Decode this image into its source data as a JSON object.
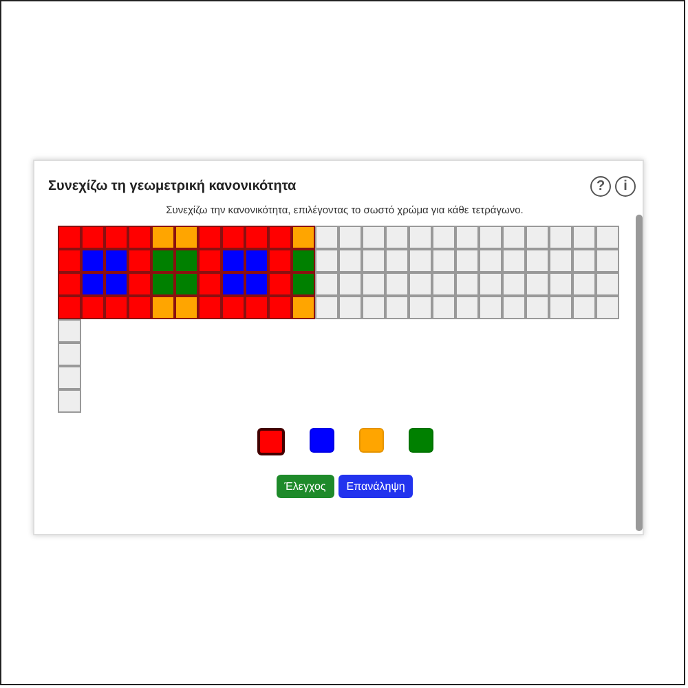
{
  "card": {
    "title": "Συνεχίζω τη γεωμετρική κανονικότητα",
    "icons": [
      "?",
      "i"
    ]
  },
  "instruction": "Συνεχίζω την κανονικότητα, επιλέγοντας το σωστό χρώμα για κάθε τετράγωνο.",
  "grid": {
    "rows": [
      [
        {
          "kind": "filled",
          "color": "#ff0000"
        },
        {
          "kind": "filled",
          "color": "#ff0000"
        },
        {
          "kind": "filled",
          "color": "#ff0000"
        },
        {
          "kind": "filled",
          "color": "#ff0000"
        },
        {
          "kind": "filled",
          "color": "#ffa500"
        },
        {
          "kind": "filled",
          "color": "#ffa500"
        },
        {
          "kind": "filled",
          "color": "#ff0000"
        },
        {
          "kind": "filled",
          "color": "#ff0000"
        },
        {
          "kind": "filled",
          "color": "#ff0000"
        },
        {
          "kind": "filled",
          "color": "#ff0000"
        },
        {
          "kind": "filled",
          "color": "#ffa500"
        },
        {
          "kind": "empty"
        },
        {
          "kind": "empty"
        },
        {
          "kind": "empty"
        },
        {
          "kind": "empty"
        },
        {
          "kind": "empty"
        },
        {
          "kind": "empty"
        },
        {
          "kind": "empty"
        },
        {
          "kind": "empty"
        },
        {
          "kind": "empty"
        },
        {
          "kind": "empty"
        },
        {
          "kind": "empty"
        },
        {
          "kind": "empty"
        },
        {
          "kind": "empty"
        }
      ],
      [
        {
          "kind": "filled",
          "color": "#ff0000"
        },
        {
          "kind": "filled",
          "color": "#0000ff"
        },
        {
          "kind": "filled",
          "color": "#0000ff"
        },
        {
          "kind": "filled",
          "color": "#ff0000"
        },
        {
          "kind": "filled",
          "color": "#008000"
        },
        {
          "kind": "filled",
          "color": "#008000"
        },
        {
          "kind": "filled",
          "color": "#ff0000"
        },
        {
          "kind": "filled",
          "color": "#0000ff"
        },
        {
          "kind": "filled",
          "color": "#0000ff"
        },
        {
          "kind": "filled",
          "color": "#ff0000"
        },
        {
          "kind": "filled",
          "color": "#008000"
        },
        {
          "kind": "empty"
        },
        {
          "kind": "empty"
        },
        {
          "kind": "empty"
        },
        {
          "kind": "empty"
        },
        {
          "kind": "empty"
        },
        {
          "kind": "empty"
        },
        {
          "kind": "empty"
        },
        {
          "kind": "empty"
        },
        {
          "kind": "empty"
        },
        {
          "kind": "empty"
        },
        {
          "kind": "empty"
        },
        {
          "kind": "empty"
        },
        {
          "kind": "empty"
        }
      ],
      [
        {
          "kind": "filled",
          "color": "#ff0000"
        },
        {
          "kind": "filled",
          "color": "#0000ff"
        },
        {
          "kind": "filled",
          "color": "#0000ff"
        },
        {
          "kind": "filled",
          "color": "#ff0000"
        },
        {
          "kind": "filled",
          "color": "#008000"
        },
        {
          "kind": "filled",
          "color": "#008000"
        },
        {
          "kind": "filled",
          "color": "#ff0000"
        },
        {
          "kind": "filled",
          "color": "#0000ff"
        },
        {
          "kind": "filled",
          "color": "#0000ff"
        },
        {
          "kind": "filled",
          "color": "#ff0000"
        },
        {
          "kind": "filled",
          "color": "#008000"
        },
        {
          "kind": "empty"
        },
        {
          "kind": "empty"
        },
        {
          "kind": "empty"
        },
        {
          "kind": "empty"
        },
        {
          "kind": "empty"
        },
        {
          "kind": "empty"
        },
        {
          "kind": "empty"
        },
        {
          "kind": "empty"
        },
        {
          "kind": "empty"
        },
        {
          "kind": "empty"
        },
        {
          "kind": "empty"
        },
        {
          "kind": "empty"
        },
        {
          "kind": "empty"
        }
      ],
      [
        {
          "kind": "filled",
          "color": "#ff0000"
        },
        {
          "kind": "filled",
          "color": "#ff0000"
        },
        {
          "kind": "filled",
          "color": "#ff0000"
        },
        {
          "kind": "filled",
          "color": "#ff0000"
        },
        {
          "kind": "filled",
          "color": "#ffa500"
        },
        {
          "kind": "filled",
          "color": "#ffa500"
        },
        {
          "kind": "filled",
          "color": "#ff0000"
        },
        {
          "kind": "filled",
          "color": "#ff0000"
        },
        {
          "kind": "filled",
          "color": "#ff0000"
        },
        {
          "kind": "filled",
          "color": "#ff0000"
        },
        {
          "kind": "filled",
          "color": "#ffa500"
        },
        {
          "kind": "empty"
        },
        {
          "kind": "empty"
        },
        {
          "kind": "empty"
        },
        {
          "kind": "empty"
        },
        {
          "kind": "empty"
        },
        {
          "kind": "empty"
        },
        {
          "kind": "empty"
        },
        {
          "kind": "empty"
        },
        {
          "kind": "empty"
        },
        {
          "kind": "empty"
        },
        {
          "kind": "empty"
        },
        {
          "kind": "empty"
        },
        {
          "kind": "empty"
        }
      ],
      [
        {
          "kind": "empty"
        }
      ],
      [
        {
          "kind": "empty"
        }
      ],
      [
        {
          "kind": "empty"
        }
      ],
      [
        {
          "kind": "empty"
        }
      ]
    ]
  },
  "palette": [
    {
      "color": "#ff0000",
      "selected": true
    },
    {
      "color": "#0000ff",
      "selected": false
    },
    {
      "color": "#ffa500",
      "selected": false
    },
    {
      "color": "#008000",
      "selected": false
    }
  ],
  "buttons": [
    {
      "label": "Έλεγχος",
      "kind": "check"
    },
    {
      "label": "Επανάληψη",
      "kind": "retry"
    }
  ]
}
